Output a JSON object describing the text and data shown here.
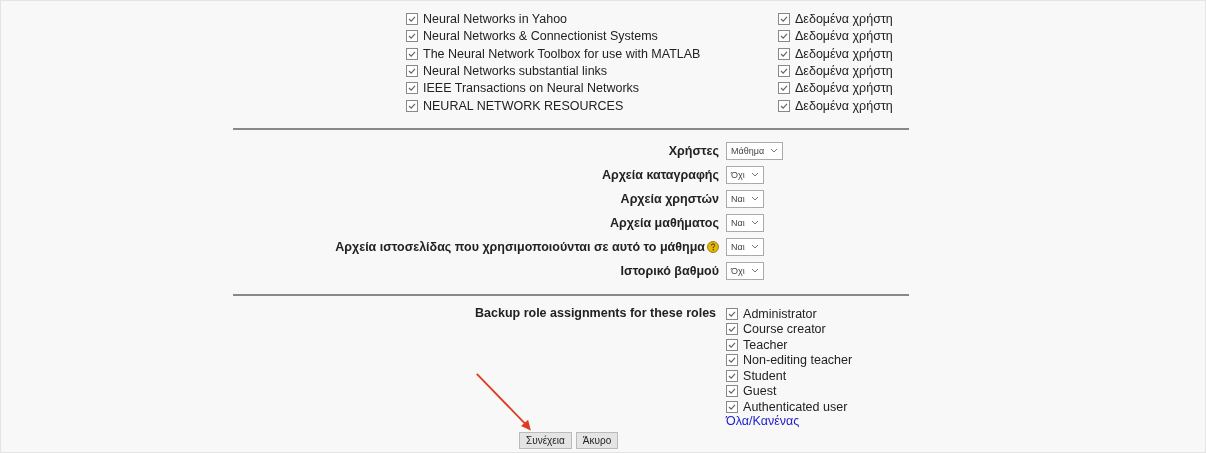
{
  "resources": [
    {
      "name": "Neural Networks in Yahoo",
      "checked": true,
      "userdata_label": "Δεδομένα χρήστη",
      "userdata_checked": true
    },
    {
      "name": "Neural Networks & Connectionist Systems",
      "checked": true,
      "userdata_label": "Δεδομένα χρήστη",
      "userdata_checked": true
    },
    {
      "name": "The Neural Network Toolbox for use with MATLAB",
      "checked": true,
      "userdata_label": "Δεδομένα χρήστη",
      "userdata_checked": true
    },
    {
      "name": "Neural Networks substantial links",
      "checked": true,
      "userdata_label": "Δεδομένα χρήστη",
      "userdata_checked": true
    },
    {
      "name": "IEEE Transactions on Neural Networks",
      "checked": true,
      "userdata_label": "Δεδομένα χρήστη",
      "userdata_checked": true
    },
    {
      "name": "NEURAL NETWORK RESOURCES",
      "checked": true,
      "userdata_label": "Δεδομένα χρήστη",
      "userdata_checked": true
    }
  ],
  "settings": [
    {
      "label": "Χρήστες",
      "value": "Μάθημα",
      "help": false
    },
    {
      "label": "Αρχεία καταγραφής",
      "value": "Όχι",
      "help": false
    },
    {
      "label": "Αρχεία χρηστών",
      "value": "Ναι",
      "help": false
    },
    {
      "label": "Αρχεία μαθήματος",
      "value": "Ναι",
      "help": false
    },
    {
      "label": "Αρχεία ιστοσελίδας που χρησιμοποιούνται σε αυτό το μάθημα",
      "value": "Ναι",
      "help": true
    },
    {
      "label": "Ιστορικό βαθμού",
      "value": "Όχι",
      "help": false
    }
  ],
  "roles": {
    "label": "Backup role assignments for these roles",
    "items": [
      {
        "name": "Administrator",
        "checked": true
      },
      {
        "name": "Course creator",
        "checked": true
      },
      {
        "name": "Teacher",
        "checked": true
      },
      {
        "name": "Non-editing teacher",
        "checked": true
      },
      {
        "name": "Student",
        "checked": true
      },
      {
        "name": "Guest",
        "checked": true
      },
      {
        "name": "Authenticated user",
        "checked": true
      }
    ],
    "select_all_link": "Όλα/Κανένας"
  },
  "buttons": [
    "Συνέχεια",
    "Άκυρο"
  ]
}
